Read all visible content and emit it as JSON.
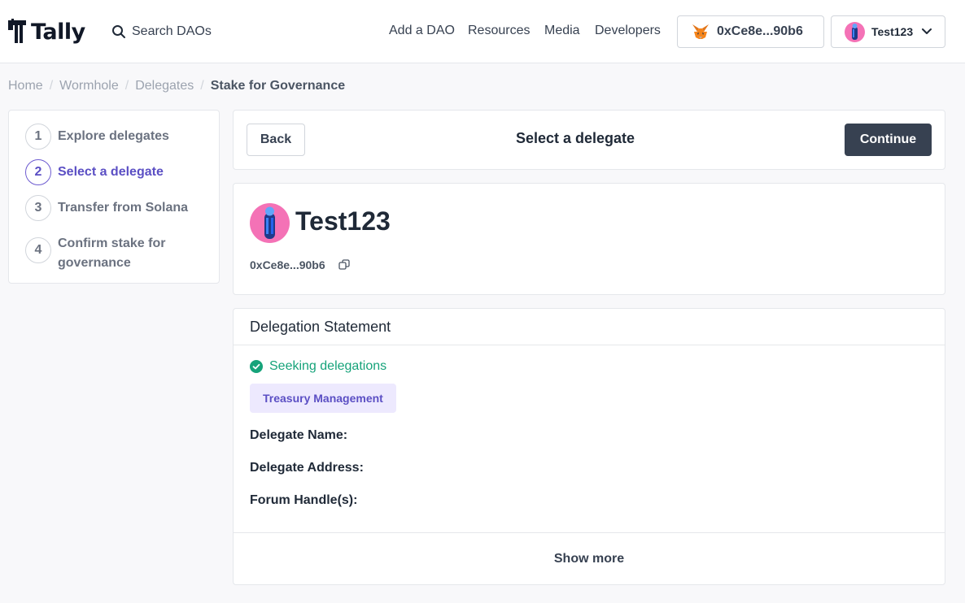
{
  "header": {
    "logo_text": "Tally",
    "search_placeholder": "Search DAOs",
    "nav": [
      {
        "label": "Add a DAO"
      },
      {
        "label": "Resources"
      },
      {
        "label": "Media"
      },
      {
        "label": "Developers"
      }
    ],
    "wallet_address": "0xCe8e...90b6",
    "user_name": "Test123"
  },
  "breadcrumb": {
    "items": [
      "Home",
      "Wormhole",
      "Delegates"
    ],
    "current": "Stake for Governance"
  },
  "steps": [
    {
      "num": "1",
      "label": "Explore delegates",
      "active": false
    },
    {
      "num": "2",
      "label": "Select a delegate",
      "active": true
    },
    {
      "num": "3",
      "label": "Transfer from Solana",
      "active": false
    },
    {
      "num": "4",
      "label": "Confirm stake for governance",
      "active": false
    }
  ],
  "action": {
    "back_label": "Back",
    "title": "Select a delegate",
    "continue_label": "Continue"
  },
  "profile": {
    "name": "Test123",
    "address": "0xCe8e...90b6"
  },
  "statement": {
    "title": "Delegation Statement",
    "status": "Seeking delegations",
    "tag": "Treasury Management",
    "fields": [
      "Delegate Name:",
      "Delegate Address:",
      "Forum Handle(s):"
    ],
    "show_more": "Show more"
  },
  "colors": {
    "accent": "#5b4fc4",
    "success": "#16a37a",
    "primary_button": "#374151",
    "avatar": "#f472b6"
  },
  "icons": [
    "tally-logo-icon",
    "search-icon",
    "metamask-fox-icon",
    "chevron-down-icon",
    "copy-icon",
    "check-circle-icon"
  ]
}
